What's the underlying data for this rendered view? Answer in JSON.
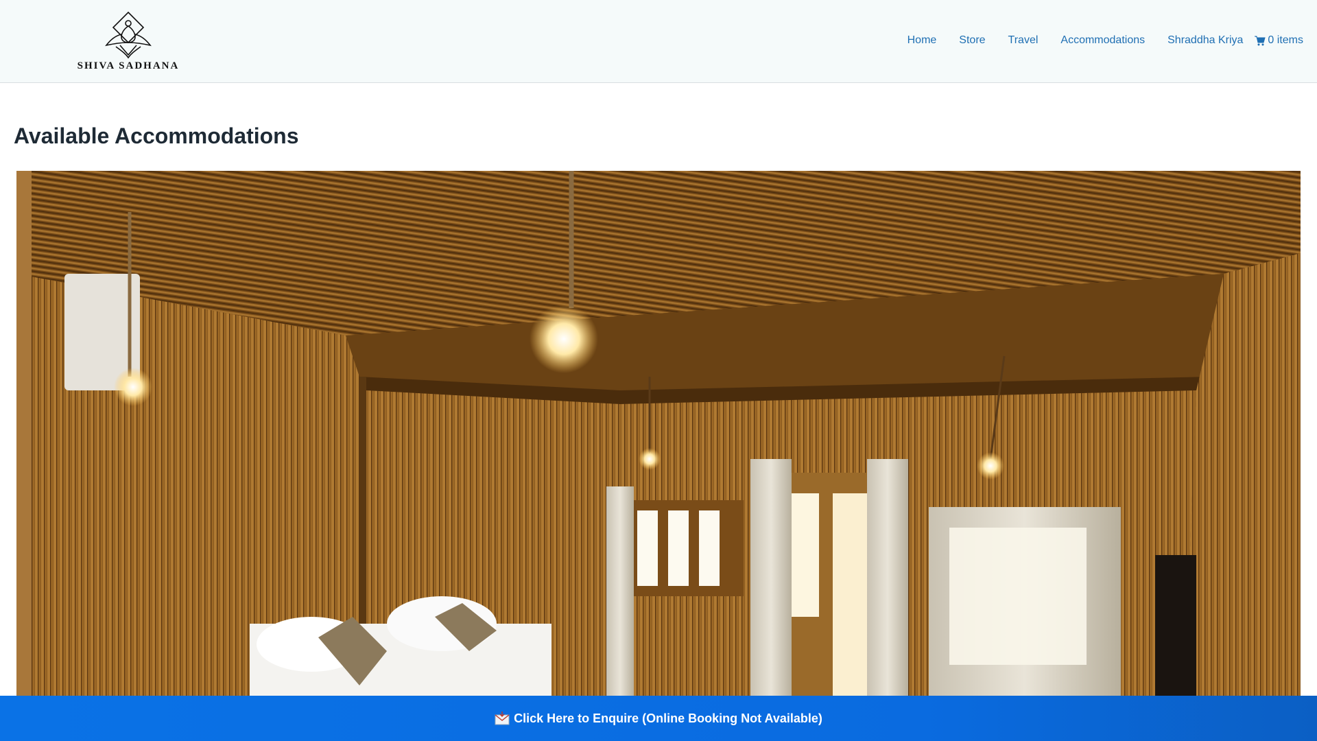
{
  "header": {
    "logo_text": "SHIVA SADHANA",
    "nav": [
      {
        "label": "Home"
      },
      {
        "label": "Store"
      },
      {
        "label": "Travel"
      },
      {
        "label": "Accommodations"
      },
      {
        "label": "Shraddha Kriya"
      }
    ],
    "cart": {
      "label": "0 items",
      "icon": "cart-icon"
    }
  },
  "main": {
    "title": "Available Accommodations",
    "photo": {
      "subject": "bamboo-walled room"
    }
  },
  "footer_banner": {
    "label": "Click Here to Enquire (Online Booking Not Available)",
    "icon": "envelope-icon"
  },
  "colors": {
    "link": "#1f6fb3",
    "banner": "#0a6be0",
    "header_bg": "#f5fafa",
    "title": "#1e2a35"
  }
}
